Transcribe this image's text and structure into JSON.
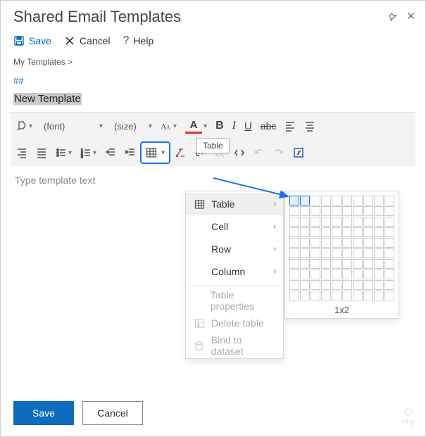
{
  "header": {
    "title": "Shared Email Templates"
  },
  "actions": {
    "save": "Save",
    "cancel": "Cancel",
    "help": "Help"
  },
  "breadcrumb": "My Templates >",
  "hash": "##",
  "template_title": "New Template",
  "toolbar": {
    "font_label": "(font)",
    "size_label": "(size)",
    "font_color_letter": "A",
    "bold": "B",
    "italic": "I",
    "underline": "U",
    "strike": "abc"
  },
  "tooltip": "Table",
  "placeholder": "Type template text",
  "menu": {
    "table": "Table",
    "cell": "Cell",
    "row": "Row",
    "column": "Column",
    "table_properties": "Table properties",
    "delete_table": "Delete table",
    "bind_dataset": "Bind to dataset"
  },
  "grid_picker": {
    "label": "1x2",
    "rows": 10,
    "cols": 10,
    "sel_row": 1,
    "sel_col": 2
  },
  "footer": {
    "save": "Save",
    "cancel": "Cancel"
  },
  "colors": {
    "accent": "#0f6cbd",
    "highlight": "#1a73e8",
    "fontUnderline": "#e03030"
  }
}
